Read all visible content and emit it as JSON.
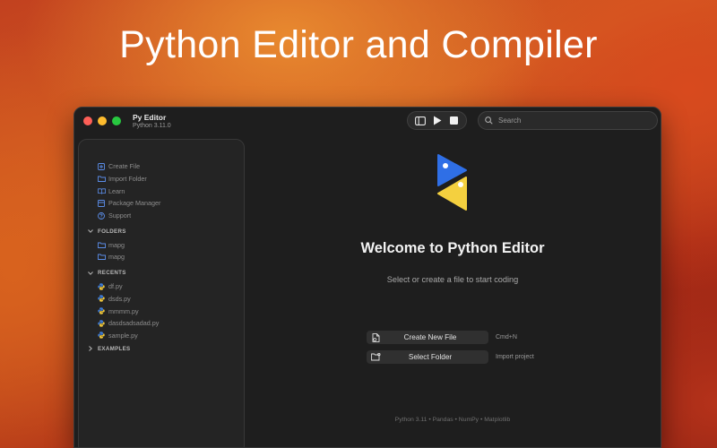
{
  "hero": {
    "title": "Python Editor and Compiler"
  },
  "window": {
    "app_title": "Py Editor",
    "app_version": "Python 3.11.0",
    "search": {
      "placeholder": "Search"
    }
  },
  "sidebar": {
    "actions": [
      {
        "label": "Create File",
        "icon": "plus-square-icon"
      },
      {
        "label": "Import Folder",
        "icon": "folder-icon"
      },
      {
        "label": "Learn",
        "icon": "book-icon"
      },
      {
        "label": "Package Manager",
        "icon": "box-icon"
      },
      {
        "label": "Support",
        "icon": "help-circle-icon"
      }
    ],
    "folders": {
      "title": "FOLDERS",
      "items": [
        "mapg",
        "mapg"
      ]
    },
    "recents": {
      "title": "RECENTS",
      "items": [
        "df.py",
        "dsds.py",
        "mmmm.py",
        "dasdsadsadad.py",
        "sample.py"
      ]
    },
    "examples": {
      "title": "EXAMPLES"
    }
  },
  "main": {
    "welcome_title": "Welcome to Python Editor",
    "welcome_subtitle": "Select or create a file to start coding",
    "create_button": {
      "label": "Create New File",
      "hint": "Cmd+N"
    },
    "folder_button": {
      "label": "Select Folder",
      "hint": "Import project"
    },
    "footer": "Python 3.11 • Pandas • NumPy • Matplotlib"
  },
  "colors": {
    "accent_blue": "#2f6fe6",
    "accent_yellow": "#f4d03f",
    "sidebar_icon_blue": "#5b8de8"
  }
}
